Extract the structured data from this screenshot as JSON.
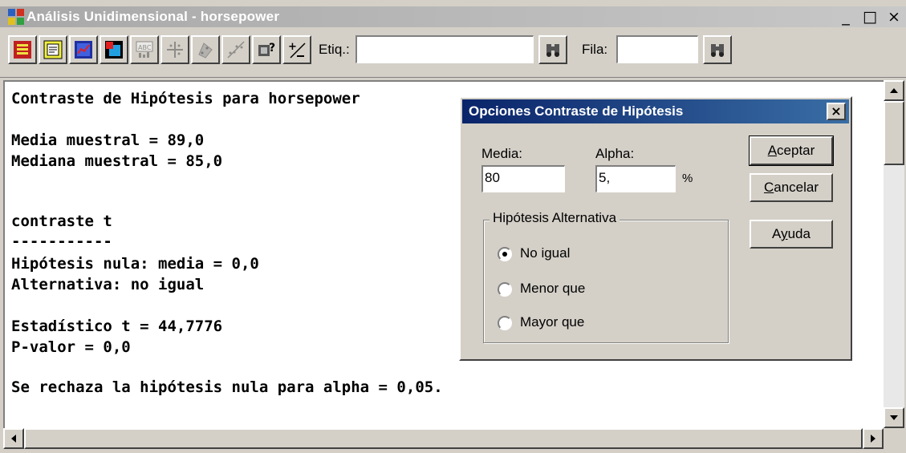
{
  "window": {
    "title": "Análisis Unidimensional - horsepower",
    "minimize_glyph": "_",
    "maximize_glyph": "□",
    "close_glyph": "×"
  },
  "toolbar": {
    "tools": [
      "input-dialog-icon",
      "text-panel-icon",
      "graph-panel-icon",
      "save-results-icon",
      "abc-stats-icon",
      "move-points-icon",
      "exclude-point-icon",
      "smooth-icon",
      "help-unknown-icon",
      "plus-minus-icon"
    ],
    "etiq_label": "Etiq.:",
    "etiq_value": "",
    "fila_label": "Fila:",
    "fila_value": "",
    "find_icon": "binoculars-icon"
  },
  "output": {
    "lines": [
      "Contraste de Hipótesis para horsepower",
      "",
      "Media muestral = 89,0",
      "Mediana muestral = 85,0",
      "",
      "",
      "contraste t",
      "-----------",
      "Hipótesis nula: media = 0,0",
      "Alternativa: no igual",
      "",
      "Estadístico t = 44,7776",
      "P-valor = 0,0",
      "",
      "Se rechaza la hipótesis nula para alpha = 0,05."
    ]
  },
  "dialog": {
    "title": "Opciones Contraste de Hipótesis",
    "close_glyph": "×",
    "media_label": "Media:",
    "media_value": "80",
    "alpha_label": "Alpha:",
    "alpha_value": "5,",
    "percent": "%",
    "group_title": "Hipótesis Alternativa",
    "options": [
      "No igual",
      "Menor que",
      "Mayor que"
    ],
    "selected_option": 0,
    "accept_label": "Aceptar",
    "cancel_label": "Cancelar",
    "help_label": "Ayuda"
  }
}
